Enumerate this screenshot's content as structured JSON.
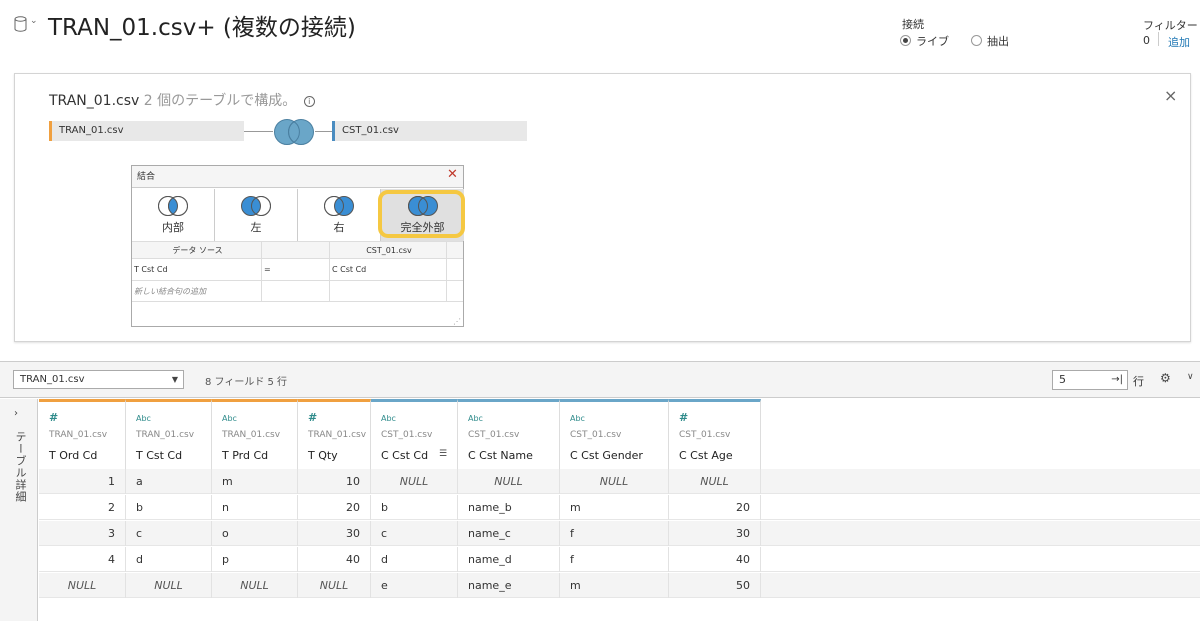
{
  "header": {
    "title": "TRAN_01.csv+ (複数の接続)",
    "connection_label": "接続",
    "live_label": "ライブ",
    "extract_label": "抽出",
    "filter_label": "フィルター",
    "filter_count": "0",
    "filter_add": "追加"
  },
  "panel": {
    "title_main": "TRAN_01.csv",
    "title_sub": "2 個のテーブルで構成。",
    "info_icon": "i",
    "close": "×",
    "left_table": "TRAN_01.csv",
    "right_table": "CST_01.csv"
  },
  "join_dialog": {
    "title": "結合",
    "close": "✕",
    "types": [
      {
        "label": "内部",
        "icon": "inner-join-icon"
      },
      {
        "label": "左",
        "icon": "left-join-icon"
      },
      {
        "label": "右",
        "icon": "right-join-icon"
      },
      {
        "label": "完全外部",
        "icon": "full-outer-join-icon"
      }
    ],
    "selected": "完全外部",
    "col_left_header": "データ ソース",
    "col_right_header": "CST_01.csv",
    "clause_left": "T Cst Cd",
    "clause_op": "=",
    "clause_right": "C Cst Cd",
    "add_clause": "新しい結合句の追加"
  },
  "toolbar": {
    "datasource": "TRAN_01.csv",
    "field_count": "8 フィールド 5 行",
    "rows_value": "5",
    "rows_go": "→|",
    "rows_label": "行",
    "gear": "⚙",
    "caret": "∨"
  },
  "side": {
    "arrow": "›",
    "label": "テーブル詳細"
  },
  "grid": {
    "columns": [
      {
        "type": "#",
        "source": "TRAN_01.csv",
        "name": "T Ord Cd"
      },
      {
        "type": "Abc",
        "source": "TRAN_01.csv",
        "name": "T Cst Cd"
      },
      {
        "type": "Abc",
        "source": "TRAN_01.csv",
        "name": "T Prd Cd"
      },
      {
        "type": "#",
        "source": "TRAN_01.csv",
        "name": "T Qty"
      },
      {
        "type": "Abc",
        "source": "CST_01.csv",
        "name": "C Cst Cd"
      },
      {
        "type": "Abc",
        "source": "CST_01.csv",
        "name": "C Cst Name"
      },
      {
        "type": "Abc",
        "source": "CST_01.csv",
        "name": "C Cst Gender"
      },
      {
        "type": "#",
        "source": "CST_01.csv",
        "name": "C Cst Age"
      }
    ],
    "rows": [
      [
        "1",
        "a",
        "m",
        "10",
        "NULL",
        "NULL",
        "NULL",
        "NULL"
      ],
      [
        "2",
        "b",
        "n",
        "20",
        "b",
        "name_b",
        "m",
        "20"
      ],
      [
        "3",
        "c",
        "o",
        "30",
        "c",
        "name_c",
        "f",
        "30"
      ],
      [
        "4",
        "d",
        "p",
        "40",
        "d",
        "name_d",
        "f",
        "40"
      ],
      [
        "NULL",
        "NULL",
        "NULL",
        "NULL",
        "e",
        "name_e",
        "m",
        "50"
      ]
    ]
  },
  "colors": {
    "tran_accent": "#f0a040",
    "cst_accent": "#6aa6c8",
    "selected_highlight": "#f5c842",
    "link": "#1f77b4"
  }
}
